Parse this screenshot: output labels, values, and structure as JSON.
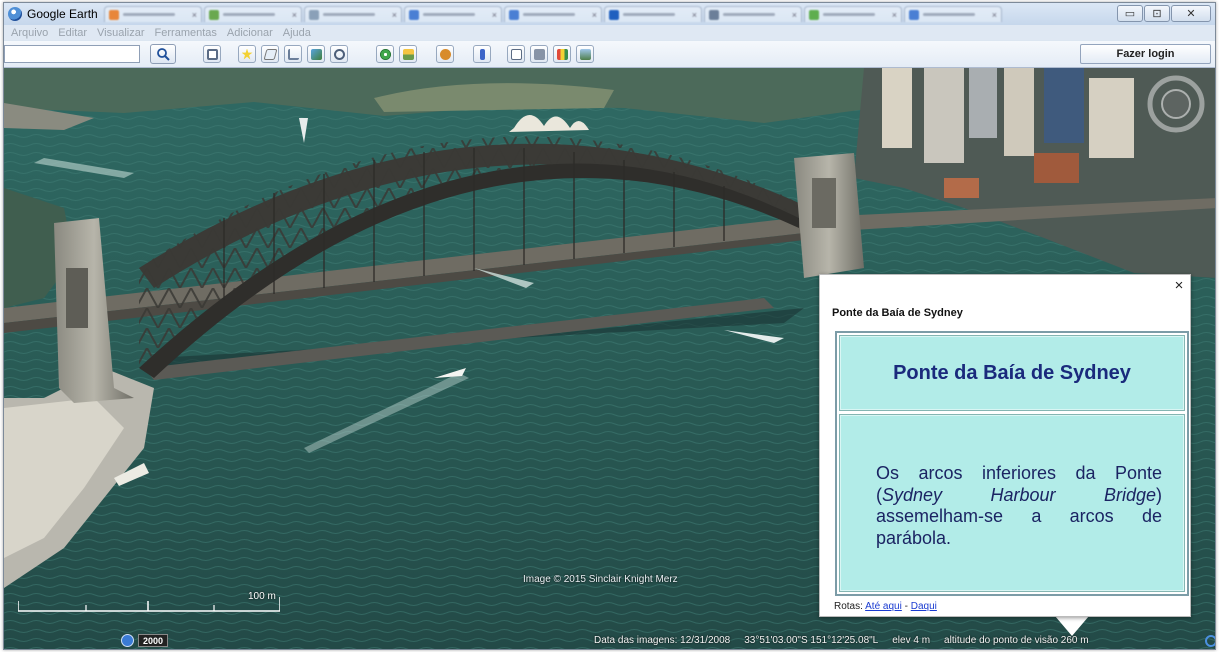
{
  "window": {
    "title": "Google Earth",
    "controls": {
      "minimize": "▭",
      "restore": "⊡",
      "close": "✕"
    }
  },
  "menu": [
    "Arquivo",
    "Editar",
    "Visualizar",
    "Ferramentas",
    "Adicionar",
    "Ajuda"
  ],
  "toolbar": {
    "search_value": "",
    "search_icon": "magnifier-icon",
    "login_label": "Fazer login"
  },
  "colors": {
    "accent": "#3a7bd5",
    "balloon_cell": "#b2ece8",
    "balloon_text": "#1a2a7c",
    "water": "#2d5b57"
  },
  "map": {
    "image_credit": "Image © 2015 Sinclair Knight Merz",
    "scale_label": "100 m",
    "history_year": "2000",
    "status": {
      "imagery_date": "Data das imagens: 12/31/2008",
      "coordinates": "33°51'03.00\"S  151°12'25.08\"L",
      "elevation": "elev    4 m",
      "eye_altitude": "altitude do ponto de visão   260 m"
    }
  },
  "balloon": {
    "title": "Ponte da Baía de Sydney",
    "heading": "Ponte da Baía de Sydney",
    "description_pre": "Os arcos inferiores da Ponte (",
    "description_italic": "Sydney Harbour Bridge",
    "description_post": ") assemelham-se a arcos de parábola.",
    "routes_label": "Rotas:",
    "route_to": "Até aqui",
    "route_separator": " - ",
    "route_from": "Daqui",
    "close_label": "×"
  }
}
